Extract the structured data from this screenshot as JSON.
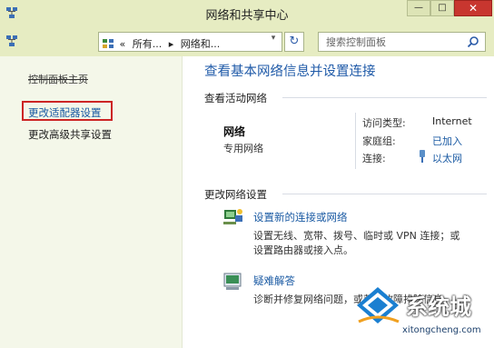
{
  "window": {
    "title": "网络和共享中心",
    "minimize_glyph": "—",
    "maximize_glyph": "□",
    "close_glyph": "✕"
  },
  "address": {
    "overflow": "«",
    "crumb1": "所有...",
    "sep": "▸",
    "crumb2": "网络和...",
    "dropdown": "▾",
    "refresh": "↻"
  },
  "search": {
    "placeholder": "搜索控制面板"
  },
  "sidebar": {
    "home": "控制面板主页",
    "items": [
      {
        "label": "更改适配器设置"
      },
      {
        "label": "更改高级共享设置"
      }
    ]
  },
  "main": {
    "title": "查看基本网络信息并设置连接",
    "active_section": "查看活动网络",
    "network": {
      "name": "网络",
      "type": "专用网络",
      "access_type_label": "访问类型:",
      "access_type": "Internet",
      "homegroup_label": "家庭组:",
      "homegroup": "已加入",
      "connection_label": "连接:",
      "connection": "以太网"
    },
    "change_section": "更改网络设置",
    "tasks": [
      {
        "link": "设置新的连接或网络",
        "desc1": "设置无线、宽带、拨号、临时或 VPN 连接；或",
        "desc2": "设置路由器或接入点。"
      },
      {
        "link": "疑难解答",
        "desc1": "诊断并修复网络问题，或获得故障排除信息。"
      }
    ]
  },
  "watermark": {
    "brand": "系统城",
    "url": "xitongcheng.com"
  },
  "colors": {
    "chrome": "#e6ecc2",
    "link": "#1a5aa3",
    "highlight_border": "#cc2525",
    "close_button": "#c8362f"
  }
}
